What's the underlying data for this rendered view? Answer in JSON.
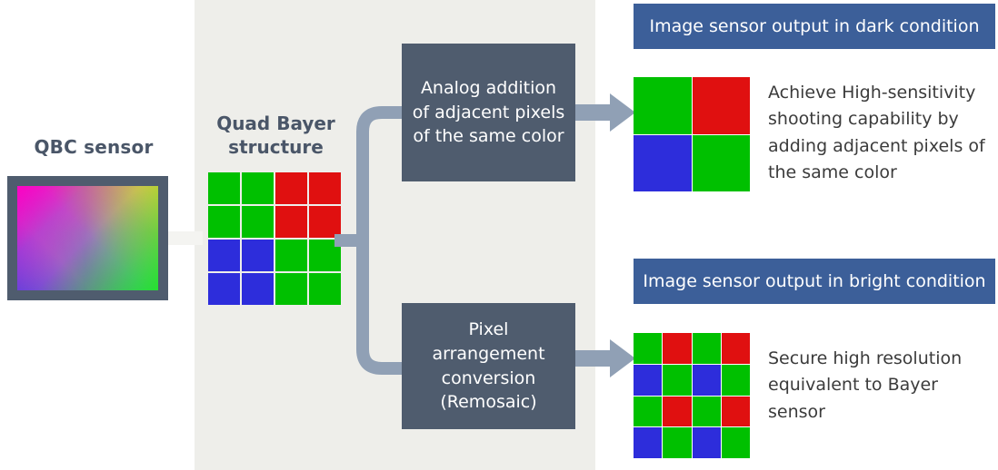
{
  "colors": {
    "panel_bg": "#eeeeea",
    "slate": "#4f5c6e",
    "header_blue": "#3c5f99",
    "connector": "#90a0b5",
    "pixel_green": "#00c000",
    "pixel_red": "#e01010",
    "pixel_blue": "#2d2ddb",
    "title_text": "#4a5668",
    "body_text": "#3b3b3b"
  },
  "sensor": {
    "title": "QBC sensor"
  },
  "quad_bayer": {
    "title": "Quad Bayer\nstructure",
    "title_line1": "Quad Bayer",
    "title_line2": "structure",
    "grid": [
      [
        "G",
        "G",
        "R",
        "R"
      ],
      [
        "G",
        "G",
        "R",
        "R"
      ],
      [
        "B",
        "B",
        "G",
        "G"
      ],
      [
        "B",
        "B",
        "G",
        "G"
      ]
    ]
  },
  "processes": [
    {
      "id": "analog-addition",
      "label": "Analog addition of adjacent pixels of the same color"
    },
    {
      "id": "remosaic",
      "label": "Pixel arrangement conversion (Remosaic)"
    }
  ],
  "outputs": [
    {
      "id": "dark",
      "header": "Image sensor output in dark condition",
      "grid": [
        [
          "G",
          "R"
        ],
        [
          "B",
          "G"
        ]
      ],
      "description": "Achieve High-sensitivity shooting capability by adding adjacent pixels of the same color"
    },
    {
      "id": "bright",
      "header": "Image sensor output in bright condition",
      "grid": [
        [
          "G",
          "R",
          "G",
          "R"
        ],
        [
          "B",
          "G",
          "B",
          "G"
        ],
        [
          "G",
          "R",
          "G",
          "R"
        ],
        [
          "B",
          "G",
          "B",
          "G"
        ]
      ],
      "description": "Secure high resolution equivalent to Bayer sensor"
    }
  ],
  "icons": {
    "arrow": "arrow-right-icon",
    "bracket": "split-connector-icon"
  }
}
